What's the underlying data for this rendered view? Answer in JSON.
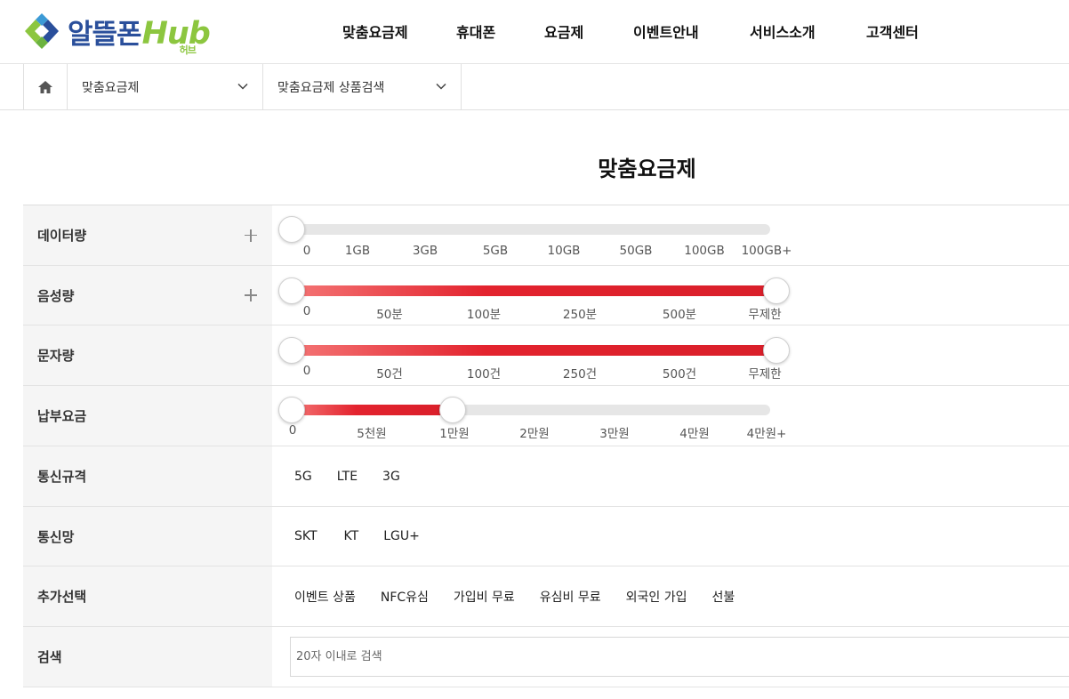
{
  "brand": {
    "name": "알뜰폰",
    "hub": "Hub",
    "sub": "허브"
  },
  "nav": [
    "맞춤요금제",
    "휴대폰",
    "요금제",
    "이벤트안내",
    "서비스소개",
    "고객센터"
  ],
  "breadcrumb": {
    "level1": "맞춤요금제",
    "level2": "맞춤요금제 상품검색"
  },
  "page_title": "맞춤요금제",
  "filters": {
    "data": {
      "label": "데이터량",
      "ticks": [
        "0",
        "1GB",
        "3GB",
        "5GB",
        "10GB",
        "50GB",
        "100GB",
        "100GB+"
      ],
      "range": [
        "0",
        "0"
      ]
    },
    "voice": {
      "label": "음성량",
      "ticks": [
        "0",
        "50분",
        "100분",
        "250분",
        "500분",
        "무제한"
      ],
      "range": [
        "0",
        "무제한"
      ]
    },
    "sms": {
      "label": "문자량",
      "ticks": [
        "0",
        "50건",
        "100건",
        "250건",
        "500건",
        "무제한"
      ],
      "range": [
        "0",
        "무제한"
      ]
    },
    "fee": {
      "label": "납부요금",
      "ticks": [
        "0",
        "5천원",
        "1만원",
        "2만원",
        "3만원",
        "4만원",
        "4만원+"
      ],
      "range": [
        "0",
        "1만원"
      ]
    },
    "network_type": {
      "label": "통신규격",
      "options": [
        "5G",
        "LTE",
        "3G"
      ]
    },
    "carrier": {
      "label": "통신망",
      "options": [
        "SKT",
        "KT",
        "LGU+"
      ]
    },
    "extra": {
      "label": "추가선택",
      "options": [
        "이벤트 상품",
        "NFC유심",
        "가입비 무료",
        "유심비 무료",
        "외국인 가입",
        "선불"
      ]
    },
    "search": {
      "label": "검색",
      "placeholder": "20자 이내로 검색",
      "value": ""
    }
  },
  "colors": {
    "accent": "#d91f2a",
    "brand_blue": "#2a4f9b",
    "brand_green": "#8cc63f"
  }
}
